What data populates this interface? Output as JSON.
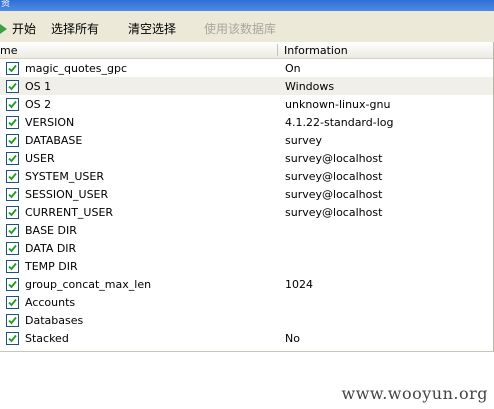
{
  "window": {
    "title_fragment": "资"
  },
  "toolbar": {
    "start_label": "开始",
    "select_all_label": "选择所有",
    "clear_selection_label": "清空选择",
    "use_database_label": "使用该数据库"
  },
  "table": {
    "columns": [
      "me",
      "Information"
    ],
    "rows": [
      {
        "name": "magic_quotes_gpc",
        "info": "On",
        "checked": true
      },
      {
        "name": "OS 1",
        "info": "Windows",
        "checked": true,
        "selected": true
      },
      {
        "name": "OS 2",
        "info": "unknown-linux-gnu",
        "checked": true
      },
      {
        "name": "VERSION",
        "info": "4.1.22-standard-log",
        "checked": true
      },
      {
        "name": "DATABASE",
        "info": "survey",
        "checked": true
      },
      {
        "name": "USER",
        "info": "survey@localhost",
        "checked": true
      },
      {
        "name": "SYSTEM_USER",
        "info": "survey@localhost",
        "checked": true
      },
      {
        "name": "SESSION_USER",
        "info": "survey@localhost",
        "checked": true
      },
      {
        "name": "CURRENT_USER",
        "info": "survey@localhost",
        "checked": true
      },
      {
        "name": "BASE DIR",
        "info": "",
        "checked": true
      },
      {
        "name": "DATA DIR",
        "info": "",
        "checked": true
      },
      {
        "name": "TEMP DIR",
        "info": "",
        "checked": true
      },
      {
        "name": "group_concat_max_len",
        "info": "1024",
        "checked": true
      },
      {
        "name": "Accounts",
        "info": "",
        "checked": true
      },
      {
        "name": "Databases",
        "info": "",
        "checked": true
      },
      {
        "name": "Stacked",
        "info": "No",
        "checked": true
      }
    ]
  },
  "watermark": "www.wooyun.org"
}
